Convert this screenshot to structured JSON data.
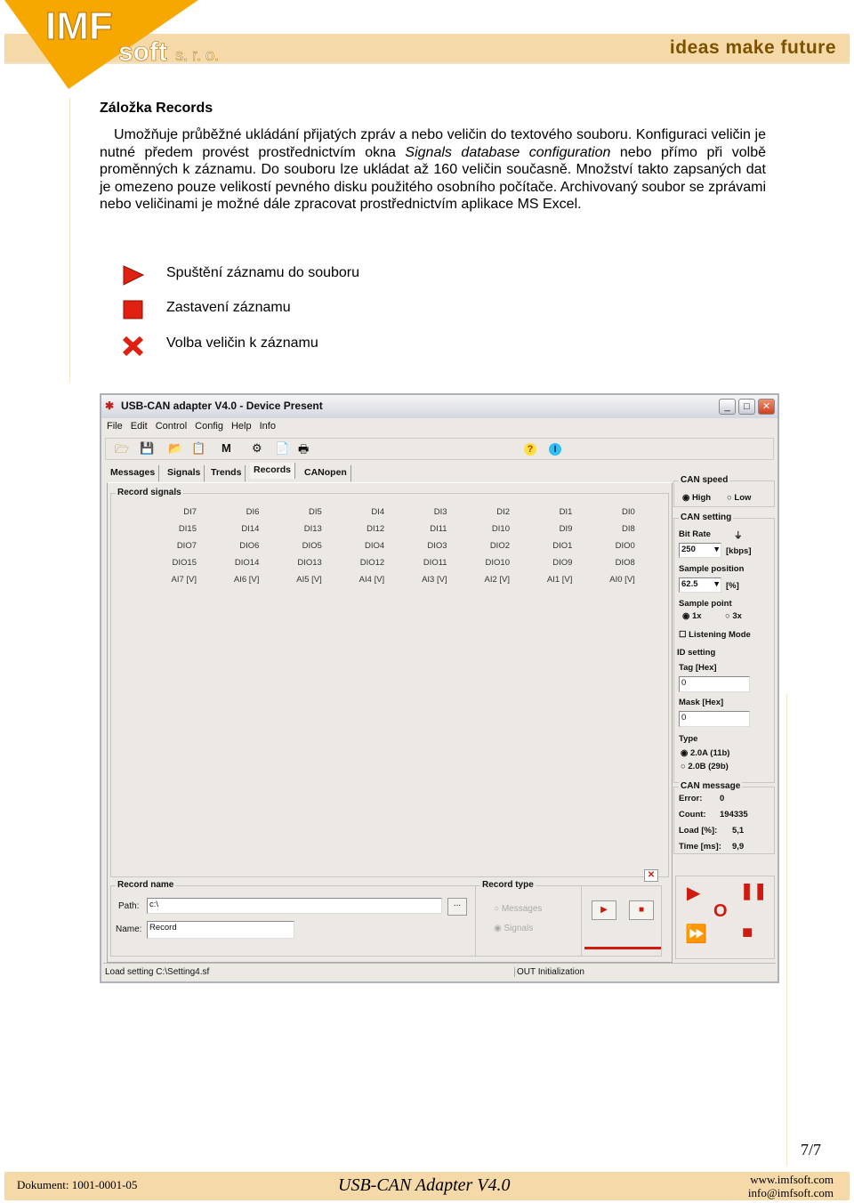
{
  "header": {
    "logo_text": "IMF soft s. r. o.",
    "slogan": "ideas make future"
  },
  "section_title": "Záložka Records",
  "paragraph_parts": [
    "Umožňuje průběžné ukládání přijatých zpráv a nebo veličin do textového souboru. Konfiguraci veličin je nutné předem provést prostřednictvím okna ",
    "Signals database configuration",
    " nebo přímo při volbě proměnných k záznamu. Do souboru lze ukládat až 160 veličin současně. Množství takto zapsaných dat je omezeno pouze velikostí pevného disku použitého osobního počítače. Archivovaný soubor se zprávami nebo veličinami je možné dále zpracovat prostřednictvím aplikace MS Excel."
  ],
  "icon_list": [
    {
      "icon": "play-icon",
      "label": "Spuštění záznamu do souboru"
    },
    {
      "icon": "stop-icon",
      "label": "Zastavení záznamu"
    },
    {
      "icon": "select-signals-icon",
      "label": "Volba veličin k záznamu"
    }
  ],
  "window": {
    "title": "USB-CAN adapter  V4.0  -  Device Present",
    "menu": [
      "File",
      "Edit",
      "Control",
      "Config",
      "Help",
      "Info"
    ],
    "tabs": [
      "Messages",
      "Signals",
      "Trends",
      "Records",
      "CANopen"
    ],
    "active_tab": "Records",
    "record_signals": {
      "label": "Record signals",
      "rows": [
        [
          "DI7",
          "DI6",
          "DI5",
          "DI4",
          "DI3",
          "DI2",
          "DI1",
          "DI0"
        ],
        [
          "DI15",
          "DI14",
          "DI13",
          "DI12",
          "DI11",
          "DI10",
          "DI9",
          "DI8"
        ],
        [
          "DIO7",
          "DIO6",
          "DIO5",
          "DIO4",
          "DIO3",
          "DIO2",
          "DIO1",
          "DIO0"
        ],
        [
          "DIO15",
          "DIO14",
          "DIO13",
          "DIO12",
          "DIO11",
          "DIO10",
          "DIO9",
          "DIO8"
        ],
        [
          "AI7 [V]",
          "AI6 [V]",
          "AI5 [V]",
          "AI4 [V]",
          "AI3 [V]",
          "AI2 [V]",
          "AI1 [V]",
          "AI0 [V]"
        ]
      ]
    },
    "record_name": {
      "label": "Record name",
      "path_label": "Path:",
      "path_value": "c:\\",
      "browse": "...",
      "name_label": "Name:",
      "name_value": "Record"
    },
    "record_type": {
      "label": "Record type",
      "options": [
        "Messages",
        "Signals"
      ],
      "selected": "Signals"
    },
    "side": {
      "can_speed": "CAN speed",
      "high": "High",
      "low": "Low",
      "speed_selected": "High",
      "can_setting": "CAN setting",
      "bit_rate": "Bit Rate",
      "bit_rate_value": "250",
      "kbps": "[kbps]",
      "sample_position": "Sample position",
      "sample_position_value": "62.5",
      "pct": "[%]",
      "sample_point": "Sample point",
      "sp1": "1x",
      "sp3": "3x",
      "listening_mode": "Listening Mode",
      "id_setting": "ID setting",
      "tag": "Tag [Hex]",
      "tag_value": "0",
      "mask": "Mask [Hex]",
      "mask_value": "0",
      "type": "Type",
      "type_a": "2.0A (11b)",
      "type_b": "2.0B (29b)",
      "can_message": "CAN message",
      "error_label": "Error:",
      "error_value": "0",
      "count_label": "Count:",
      "count_value": "194335",
      "load_label": "Load [%]:",
      "load_value": "5,1",
      "time_label": "Time [ms]:",
      "time_value": "9,9"
    },
    "status": [
      "Load setting C:\\Setting4.sf",
      "OUT Initialization"
    ]
  },
  "footer": {
    "page": "7/7",
    "document": "Dokument: 1001-0001-05",
    "product": "USB-CAN Adapter V4.0",
    "web": "www.imfsoft.com",
    "email": "info@imfsoft.com"
  },
  "colors": {
    "band": "#f6d9a8",
    "logo_orange": "#f7a800",
    "record_red": "#d01a10"
  }
}
